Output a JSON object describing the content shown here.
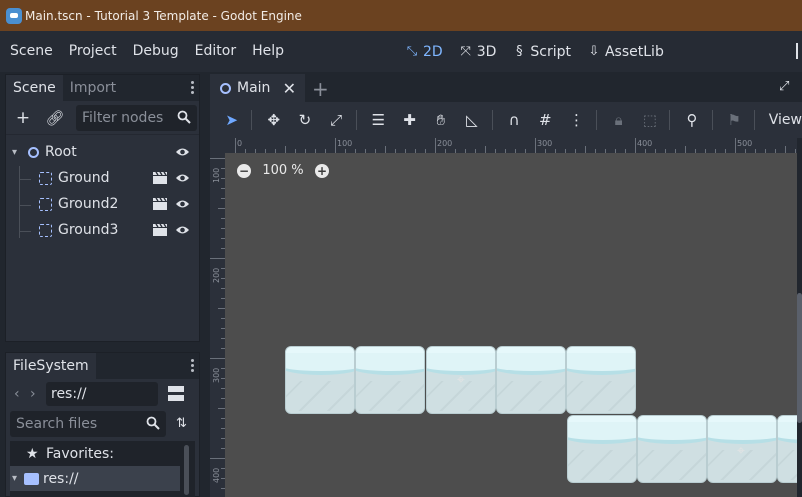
{
  "window": {
    "title": "Main.tscn - Tutorial 3 Template - Godot Engine",
    "app_icon": "godot-icon"
  },
  "menubar": {
    "items": [
      "Scene",
      "Project",
      "Debug",
      "Editor",
      "Help"
    ],
    "modes": [
      {
        "label": "2D",
        "icon": "2d-icon",
        "active": true
      },
      {
        "label": "3D",
        "icon": "3d-icon",
        "active": false
      },
      {
        "label": "Script",
        "icon": "script-icon",
        "active": false
      },
      {
        "label": "AssetLib",
        "icon": "assetlib-icon",
        "active": false
      }
    ]
  },
  "scene_dock": {
    "tabs": [
      "Scene",
      "Import"
    ],
    "active_tab": "Scene",
    "filter_placeholder": "Filter nodes",
    "tree": [
      {
        "label": "Root",
        "type": "Node2D",
        "level": 0,
        "expanded": true
      },
      {
        "label": "Ground",
        "type": "instance",
        "level": 1
      },
      {
        "label": "Ground2",
        "type": "instance",
        "level": 1
      },
      {
        "label": "Ground3",
        "type": "instance",
        "level": 1
      }
    ]
  },
  "filesystem_dock": {
    "tab": "FileSystem",
    "path": "res://",
    "search_placeholder": "Search files",
    "items": [
      {
        "label": "Favorites:",
        "icon": "star-icon"
      },
      {
        "label": "res://",
        "icon": "folder-icon",
        "selected": true
      }
    ]
  },
  "editor": {
    "tabs": [
      {
        "label": "Main",
        "active": true
      }
    ],
    "toolbar_view_label": "View",
    "zoom_label": "100 %",
    "ruler_top_labels": [
      "0",
      "100",
      "200",
      "300",
      "400",
      "500"
    ],
    "ruler_left_labels": [
      "100",
      "200",
      "300",
      "400"
    ]
  },
  "colors": {
    "titlebar": "#6b4220",
    "accent": "#6fa8ff",
    "viewport_bg": "#4d4d4d"
  }
}
